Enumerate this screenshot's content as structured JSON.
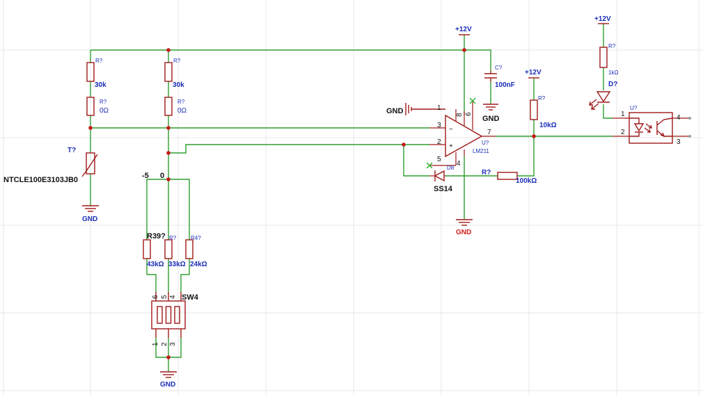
{
  "power": {
    "vcc_opamp": "+12V",
    "vcc_pullup": "+12V",
    "vcc_optocoupler": "+12V"
  },
  "ground": {
    "thermistor": "GND",
    "cap": "GND",
    "opamp_pin1": "GND",
    "opamp_bottom": "GND",
    "switch": "GND"
  },
  "components": {
    "r_left_top": {
      "ref": "R?",
      "value": "30k"
    },
    "r_left_bottom": {
      "ref": "R?",
      "value": "0Ω"
    },
    "r_mid_top": {
      "ref": "R?",
      "value": "30k"
    },
    "r_mid_bottom": {
      "ref": "R?",
      "value": "0Ω"
    },
    "thermistor": {
      "ref": "T?",
      "value": "NTCLE100E3103JB0"
    },
    "r39": {
      "ref": "R39?",
      "value": "43kΩ"
    },
    "r_33k": {
      "ref": "R?",
      "value": "33kΩ"
    },
    "r4": {
      "ref": "R4?",
      "value": "24kΩ"
    },
    "switch": {
      "ref": "SW4",
      "pins_top": [
        "6",
        "5",
        "4"
      ],
      "pins_bottom": [
        "1",
        "2",
        "3"
      ]
    },
    "cap": {
      "ref": "C?",
      "value": "100nF"
    },
    "opamp": {
      "ref": "U?",
      "value": "LM211",
      "pins": {
        "p1": "1",
        "p2": "2",
        "p3": "3",
        "p4": "4",
        "p5": "5",
        "p6": "6",
        "p7": "7",
        "p8": "8"
      },
      "minus": "−",
      "plus": "+"
    },
    "diode": {
      "ref": "D8",
      "value": "SS14"
    },
    "r_feedback": {
      "ref": "R?",
      "value": "100kΩ"
    },
    "r_pullup": {
      "ref": "R?",
      "value": "10kΩ"
    },
    "r_led": {
      "ref": "R?",
      "value": "1kΩ"
    },
    "led": {
      "ref": "D?"
    },
    "opto": {
      "ref": "U?",
      "pins": {
        "p1": "1",
        "p2": "2",
        "p3": "3",
        "p4": "4"
      }
    }
  },
  "net_labels": {
    "minus5": "-5",
    "zero": "0"
  }
}
